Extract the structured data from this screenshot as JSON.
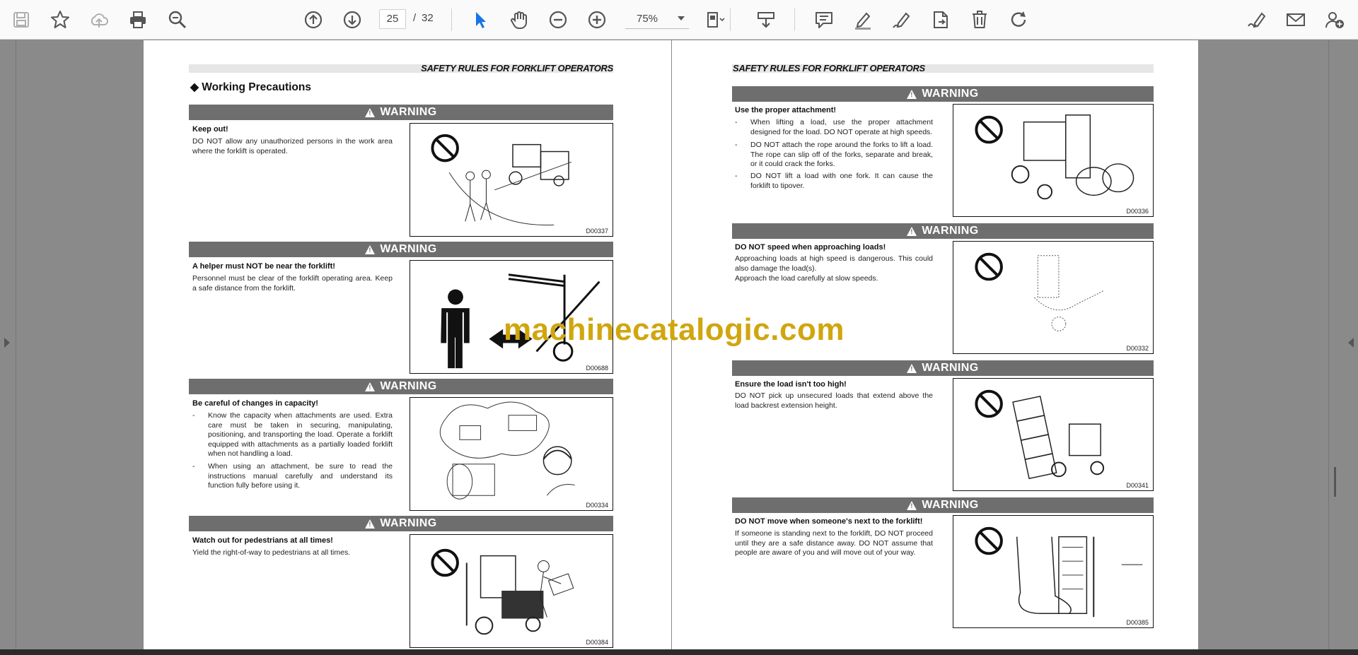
{
  "toolbar": {
    "current_page": "25",
    "page_separator": "/",
    "total_pages": "32",
    "zoom": "75%",
    "icons": [
      "save-icon",
      "bookmark-star-icon",
      "cloud-upload-icon",
      "print-icon",
      "zoom-out-search-icon",
      "page-up-icon",
      "page-down-icon",
      "select-cursor-icon",
      "hand-icon",
      "zoom-out-icon",
      "zoom-in-icon",
      "fit-page-icon",
      "scroll-mode-icon",
      "comment-icon",
      "highlight-icon",
      "draw-icon",
      "share-doc-icon",
      "delete-icon",
      "rotate-icon",
      "sign-icon",
      "email-icon",
      "add-user-icon"
    ]
  },
  "left_page": {
    "header": "SAFETY RULES FOR FORKLIFT OPERATORS",
    "section_title": "Working Precautions",
    "warnings": [
      {
        "banner": "WARNING",
        "title": "Keep out!",
        "text": "DO NOT allow any unauthorized persons in the work area where the forklift is operated.",
        "fig_code": "D00337"
      },
      {
        "banner": "WARNING",
        "title": "A helper must NOT be near the forklift!",
        "text": "Personnel must be clear of the forklift operating area. Keep a safe distance from the forklift.",
        "fig_code": "D00688"
      },
      {
        "banner": "WARNING",
        "title": "Be careful of changes in capacity!",
        "bullets": [
          "Know the capacity when attachments are used. Extra care must be taken in securing, manipulating, positioning, and transporting the load. Operate a forklift equipped with attachments as a partially loaded forklift when not handling a load.",
          "When using an attachment, be sure to read the instructions manual carefully and understand its function fully before using it."
        ],
        "fig_code": "D00334"
      },
      {
        "banner": "WARNING",
        "title": "Watch out for pedestrians at all times!",
        "text": "Yield the right-of-way to pedestrians at all times.",
        "fig_code": "D00384"
      }
    ]
  },
  "right_page": {
    "header": "SAFETY RULES FOR FORKLIFT OPERATORS",
    "warnings": [
      {
        "banner": "WARNING",
        "title": "Use the proper attachment!",
        "bullets": [
          "When lifting a load, use the proper attachment designed for the load. DO NOT operate at high speeds.",
          "DO NOT attach the rope around the forks to lift a load. The rope can slip off of the forks, separate and break, or it could crack the forks.",
          "DO NOT lift a load with one fork. It can cause the forklift to tipover."
        ],
        "fig_code": "D00336"
      },
      {
        "banner": "WARNING",
        "title": "DO NOT speed when approaching loads!",
        "text": "Approaching loads at high speed is dangerous. This could also damage the load(s).",
        "text2": "Approach the load carefully at slow speeds.",
        "fig_code": "D00332"
      },
      {
        "banner": "WARNING",
        "title": "Ensure the load isn't too high!",
        "text": "DO NOT pick up unsecured loads that extend above the load backrest extension height.",
        "fig_code": "D00341"
      },
      {
        "banner": "WARNING",
        "title": "DO NOT move when someone's next to the forklift!",
        "text": "If someone is standing next to the forklift, DO NOT proceed until they are a safe distance away. DO NOT assume that people are aware of you and will move out of your way.",
        "fig_code": "D00385"
      }
    ]
  },
  "watermark": "machinecatalogic.com",
  "colors": {
    "accent_select": "#1a73e8",
    "warning_bar": "#6e6e6e",
    "watermark": "#d0a60f",
    "viewer_bg": "#8a8a8a"
  }
}
